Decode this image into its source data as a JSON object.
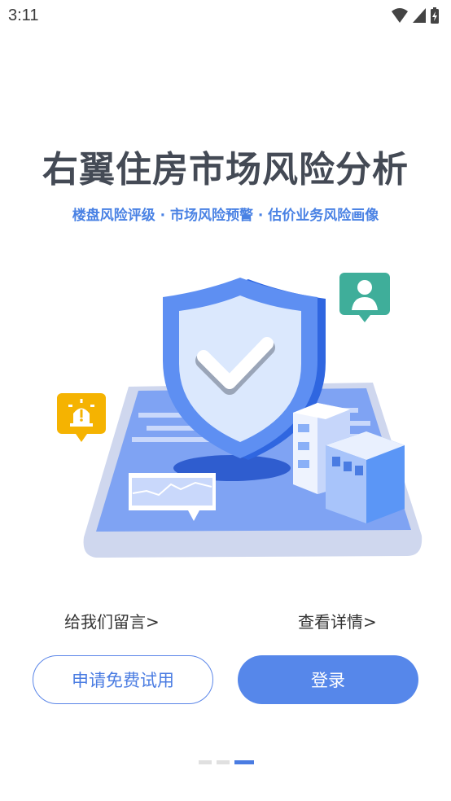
{
  "status_bar": {
    "time": "3:11"
  },
  "title": "右翼住房市场风险分析",
  "subtitle": "楼盘风险评级 · 市场风险预警 · 估价业务风险画像",
  "links": {
    "feedback": "给我们留言>",
    "details": "查看详情>"
  },
  "buttons": {
    "trial": "申请免费试用",
    "login": "登录"
  },
  "pager": {
    "count": 3,
    "active_index": 2
  },
  "colors": {
    "accent": "#5687ea",
    "title": "#444a55",
    "subtitle": "#4a82e4",
    "alert": "#f5b301",
    "user_badge": "#3fae9a"
  }
}
